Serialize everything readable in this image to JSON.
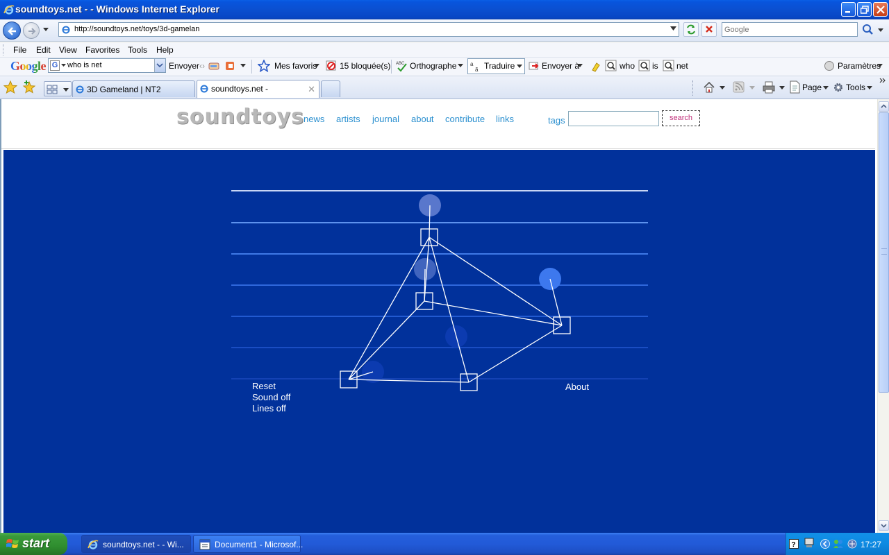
{
  "window": {
    "title": "soundtoys.net - - Windows Internet Explorer"
  },
  "address": {
    "url": "http://soundtoys.net/toys/3d-gamelan",
    "search_placeholder": "Google"
  },
  "menubar": {
    "items": [
      "File",
      "Edit",
      "View",
      "Favorites",
      "Tools",
      "Help"
    ]
  },
  "google_toolbar": {
    "logo": "Google",
    "query": "who is net",
    "send_label": "Envoyer",
    "favorites_label": "Mes favoris",
    "blocked_label": "15 bloquée(s)",
    "spelling_label": "Orthographe",
    "translate_label": "Traduire",
    "send_to_label": "Envoyer à",
    "terms": [
      "who",
      "is",
      "net"
    ],
    "settings_label": "Paramètres"
  },
  "tabs": [
    {
      "label": "3D Gameland | NT2"
    },
    {
      "label": "soundtoys.net -"
    }
  ],
  "command_bar": {
    "page_label": "Page",
    "tools_label": "Tools"
  },
  "site": {
    "logo": "soundtoys",
    "nav": [
      "news",
      "artists",
      "journal",
      "about",
      "contribute",
      "links"
    ],
    "tags_label": "tags",
    "search_label": "search"
  },
  "stage": {
    "links": {
      "reset": "Reset",
      "sound": "Sound off",
      "lines": "Lines off",
      "about": "About"
    },
    "colors": {
      "background": "#01319b",
      "lines": [
        "#c8d6f5",
        "#5d92ee",
        "#3f79e6",
        "#2f68dc",
        "#225ad0",
        "#1a4dc2",
        "#1442b4"
      ]
    }
  },
  "taskbar": {
    "start_label": "start",
    "tasks": [
      {
        "label": "soundtoys.net - - Wi..."
      },
      {
        "label": "Document1 - Microsof..."
      }
    ],
    "clock": "17:27"
  }
}
